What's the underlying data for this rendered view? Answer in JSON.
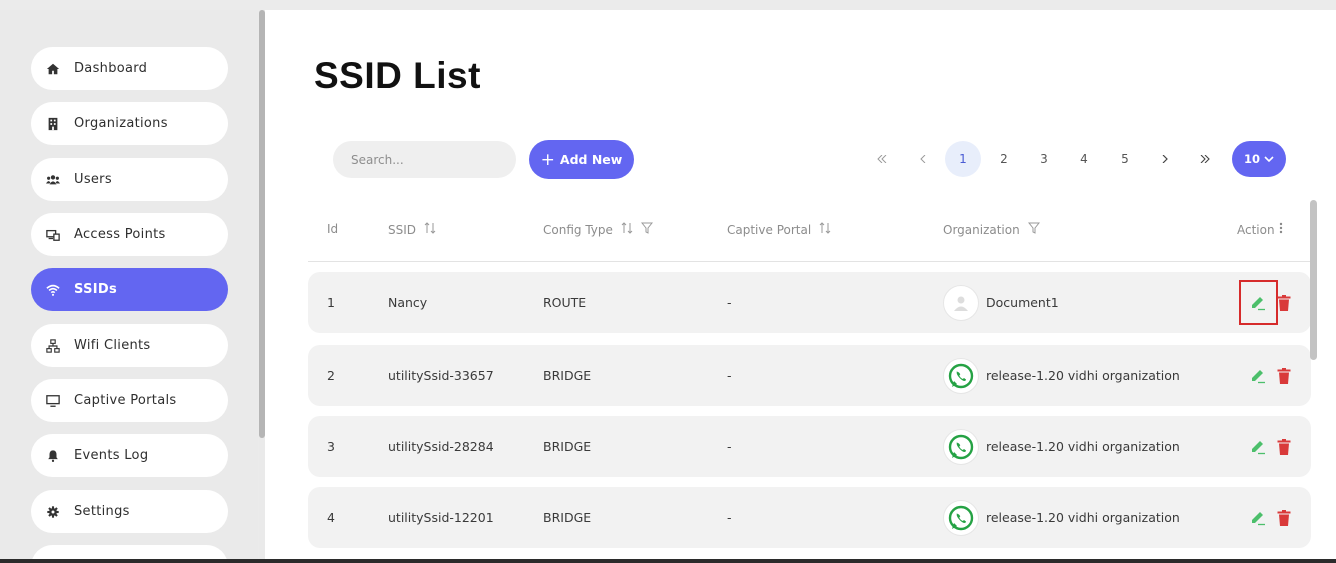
{
  "sidebar": {
    "items": [
      {
        "label": "Dashboard",
        "icon": "home-icon",
        "active": false
      },
      {
        "label": "Organizations",
        "icon": "building-icon",
        "active": false
      },
      {
        "label": "Users",
        "icon": "users-icon",
        "active": false
      },
      {
        "label": "Access Points",
        "icon": "access-point-icon",
        "active": false
      },
      {
        "label": "SSIDs",
        "icon": "wifi-icon",
        "active": true
      },
      {
        "label": "Wifi Clients",
        "icon": "network-icon",
        "active": false
      },
      {
        "label": "Captive Portals",
        "icon": "monitor-icon",
        "active": false
      },
      {
        "label": "Events Log",
        "icon": "bell-icon",
        "active": false
      },
      {
        "label": "Settings",
        "icon": "gear-icon",
        "active": false
      }
    ]
  },
  "page": {
    "title": "SSID List"
  },
  "toolbar": {
    "search_placeholder": "Search...",
    "add_label": "Add New",
    "pages": [
      "1",
      "2",
      "3",
      "4",
      "5"
    ],
    "current_page": "1",
    "rows_per_page": "10"
  },
  "table": {
    "headers": {
      "id": "Id",
      "ssid": "SSID",
      "config_type": "Config Type",
      "captive_portal": "Captive Portal",
      "organization": "Organization",
      "action": "Action"
    },
    "rows": [
      {
        "id": "1",
        "ssid": "Nancy",
        "config_type": "ROUTE",
        "captive_portal": "-",
        "organization": "Document1",
        "org_icon": "user-avatar-icon"
      },
      {
        "id": "2",
        "ssid": "utilitySsid-33657",
        "config_type": "BRIDGE",
        "captive_portal": "-",
        "organization": "release-1.20 vidhi organization",
        "org_icon": "whatsapp-icon"
      },
      {
        "id": "3",
        "ssid": "utilitySsid-28284",
        "config_type": "BRIDGE",
        "captive_portal": "-",
        "organization": "release-1.20 vidhi organization",
        "org_icon": "whatsapp-icon"
      },
      {
        "id": "4",
        "ssid": "utilitySsid-12201",
        "config_type": "BRIDGE",
        "captive_portal": "-",
        "organization": "release-1.20 vidhi organization",
        "org_icon": "whatsapp-icon"
      }
    ]
  },
  "colors": {
    "accent": "#6366f1",
    "edit": "#4cbf6b",
    "delete": "#d93a3a",
    "highlight": "#d62b2b"
  }
}
